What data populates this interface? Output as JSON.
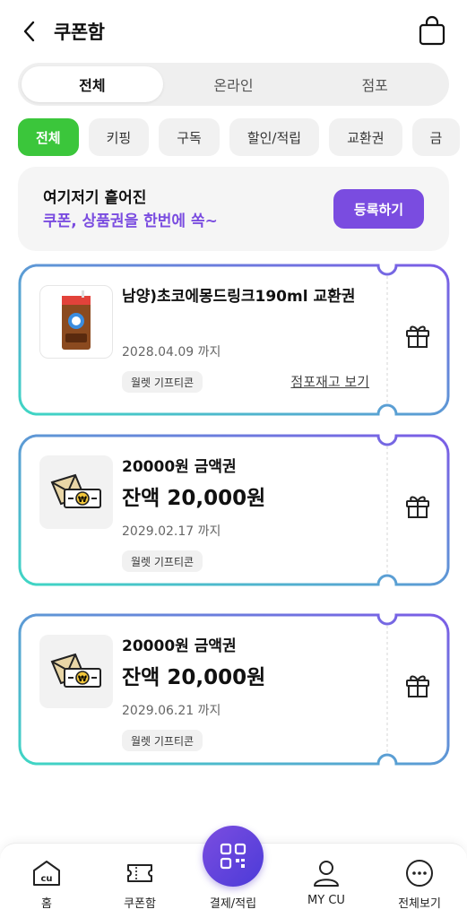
{
  "header": {
    "title": "쿠폰함",
    "back_icon": "chevron-left-icon",
    "bag_icon": "shopping-bag-icon"
  },
  "segments": [
    {
      "label": "전체",
      "active": true
    },
    {
      "label": "온라인",
      "active": false
    },
    {
      "label": "점포",
      "active": false
    }
  ],
  "chips": [
    {
      "label": "전체",
      "active": true
    },
    {
      "label": "키핑",
      "active": false
    },
    {
      "label": "구독",
      "active": false
    },
    {
      "label": "할인/적립",
      "active": false
    },
    {
      "label": "교환권",
      "active": false
    },
    {
      "label": "금",
      "active": false
    }
  ],
  "banner": {
    "line1": "여기저기 흩어진",
    "line2": "쿠폰, 상품권을 한번에 쏙~",
    "button": "등록하기"
  },
  "coupons": [
    {
      "name": "남양)초코에몽드링크190ml 교환권",
      "date": "2028.04.09 까지",
      "badge": "월렛 기프티콘",
      "link": "점포재고 보기"
    },
    {
      "name": "20000원 금액권",
      "amount": "잔액 20,000원",
      "date": "2029.02.17 까지",
      "badge": "월렛 기프티콘"
    },
    {
      "name": "20000원 금액권",
      "amount": "잔액 20,000원",
      "date": "2029.06.21 까지",
      "badge": "월렛 기프티콘"
    }
  ],
  "colors": {
    "accent_purple": "#7a4ce0",
    "chip_green": "#3bc63b",
    "border_teal": "#3fd6c4",
    "border_purple": "#7b5ce6"
  },
  "bottom_nav": [
    {
      "label": "홈",
      "icon": "cu-home-icon"
    },
    {
      "label": "쿠폰함",
      "icon": "ticket-icon"
    },
    {
      "label": "결제/적립",
      "icon": "qr-code-icon"
    },
    {
      "label": "MY CU",
      "icon": "person-icon"
    },
    {
      "label": "전체보기",
      "icon": "more-icon"
    }
  ]
}
